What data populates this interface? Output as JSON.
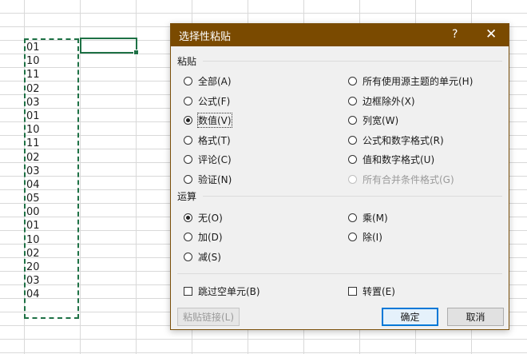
{
  "sheet": {
    "cell_values": [
      "01",
      "10",
      "11",
      "02",
      "03",
      "01",
      "10",
      "11",
      "02",
      "03",
      "04",
      "05",
      "00",
      "01",
      "10",
      "02",
      "20",
      "03",
      "04"
    ]
  },
  "dialog": {
    "title": "选择性粘贴",
    "help_label": "?",
    "close_label": "✕",
    "paste": {
      "section_label": "粘贴",
      "options_left": [
        "全部(A)",
        "公式(F)",
        "数值(V)",
        "格式(T)",
        "评论(C)",
        "验证(N)"
      ],
      "options_right": [
        "所有使用源主题的单元(H)",
        "边框除外(X)",
        "列宽(W)",
        "公式和数字格式(R)",
        "值和数字格式(U)",
        "所有合并条件格式(G)"
      ],
      "selected": "数值(V)"
    },
    "operation": {
      "section_label": "运算",
      "options_left": [
        "无(O)",
        "加(D)",
        "减(S)"
      ],
      "options_right": [
        "乘(M)",
        "除(I)"
      ],
      "selected": "无(O)"
    },
    "skip_blanks_label": "跳过空单元(B)",
    "transpose_label": "转置(E)",
    "paste_link_label": "粘贴链接(L)",
    "ok_label": "确定",
    "cancel_label": "取消"
  },
  "colors": {
    "title_bar": "#7a4a00",
    "selection_border": "#1e7145",
    "primary_button_border": "#0078d7"
  }
}
